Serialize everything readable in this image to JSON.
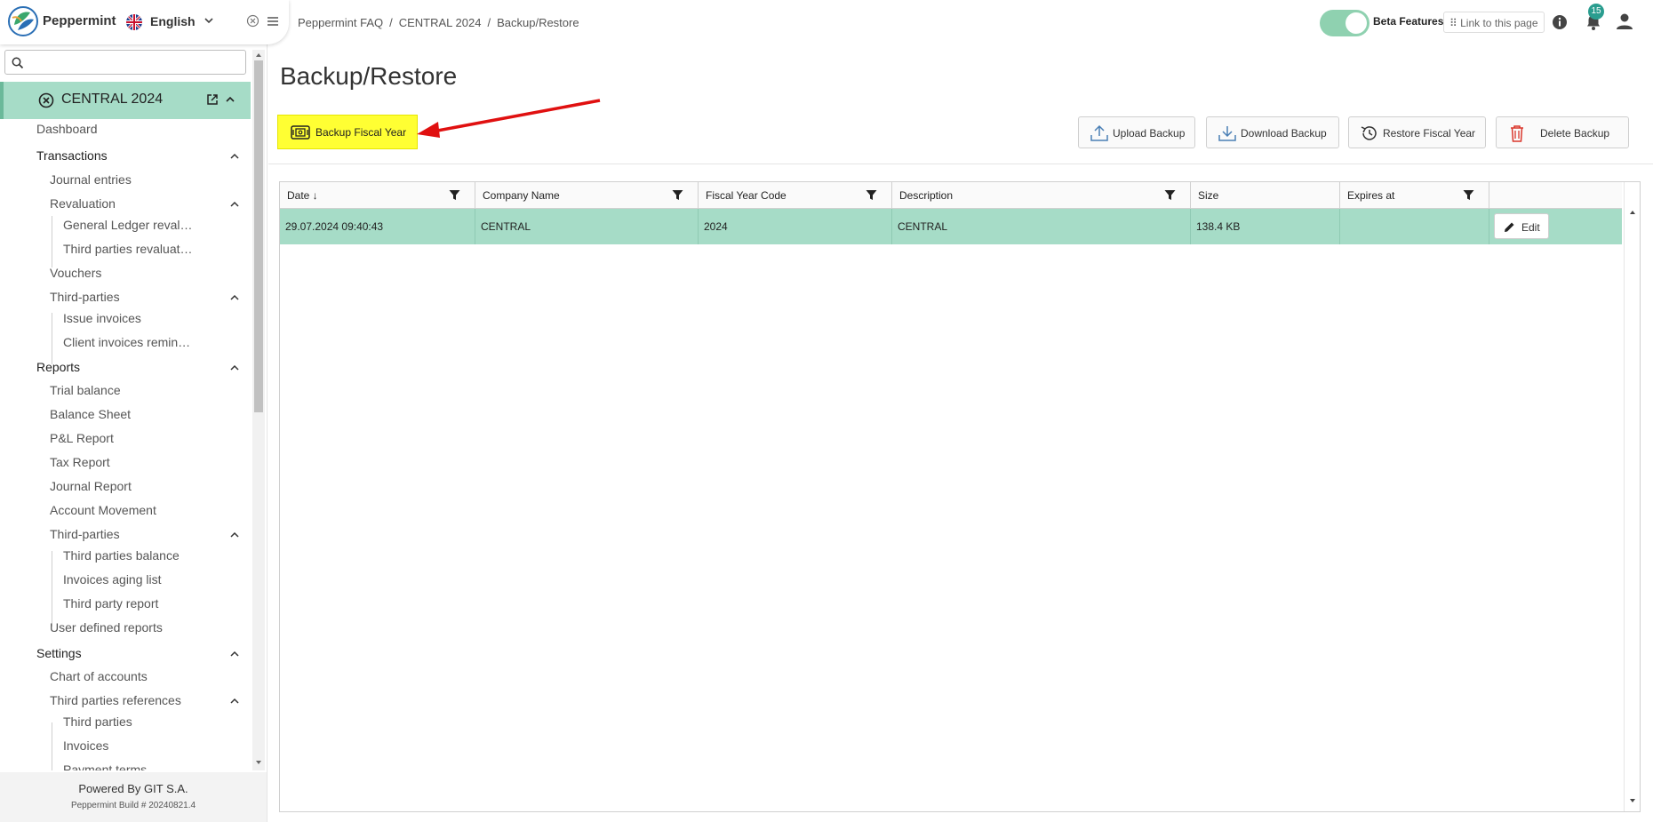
{
  "app": {
    "name": "Peppermint",
    "language": "English"
  },
  "sidebar": {
    "search_placeholder": "",
    "current": "CENTRAL 2024",
    "items": {
      "dashboard": "Dashboard",
      "transactions": "Transactions",
      "journal_entries": "Journal entries",
      "revaluation": "Revaluation",
      "gl_reval": "General Ledger reval…",
      "tp_reval": "Third parties revaluat…",
      "vouchers": "Vouchers",
      "third_parties": "Third-parties",
      "issue_invoices": "Issue invoices",
      "client_reminders": "Client invoices remin…",
      "reports": "Reports",
      "trial_balance": "Trial balance",
      "balance_sheet": "Balance Sheet",
      "pl_report": "P&L Report",
      "tax_report": "Tax Report",
      "journal_report": "Journal Report",
      "account_movement": "Account Movement",
      "reports_third_parties": "Third-parties",
      "tp_balance": "Third parties balance",
      "aging_list": "Invoices aging list",
      "tp_report": "Third party report",
      "user_reports": "User defined reports",
      "settings": "Settings",
      "chart_accounts": "Chart of accounts",
      "tp_references": "Third parties references",
      "set_third_parties": "Third parties",
      "set_invoices": "Invoices",
      "payment_terms": "Payment terms"
    },
    "footer": {
      "powered": "Powered By GIT S.A.",
      "build": "Peppermint Build # 20240821.4"
    }
  },
  "breadcrumb": [
    "Peppermint FAQ",
    "CENTRAL 2024",
    "Backup/Restore"
  ],
  "breadcrumb_sep": "/",
  "topbar": {
    "beta_label": "Beta Features",
    "link_label": "⠿ Link to this page",
    "notifications": "15"
  },
  "page": {
    "title": "Backup/Restore"
  },
  "toolbar": {
    "backup_fiscal_year": "Backup Fiscal Year",
    "upload_backup": "Upload Backup",
    "download_backup": "Download Backup",
    "restore_fiscal_year": "Restore Fiscal Year",
    "delete_backup": "Delete Backup"
  },
  "grid": {
    "columns": [
      "Date ↓",
      "Company Name",
      "Fiscal Year Code",
      "Description",
      "Size",
      "Expires at"
    ],
    "rows": [
      {
        "date": "29.07.2024 09:40:43",
        "company": "CENTRAL",
        "fy_code": "2024",
        "description": "CENTRAL",
        "size": "138.4 KB",
        "expires": "",
        "action": "Edit"
      }
    ]
  },
  "colors": {
    "accent": "#a6dcc7",
    "highlight": "#ffff33",
    "arrow": "#e01010",
    "badge": "#2a9d8f"
  }
}
